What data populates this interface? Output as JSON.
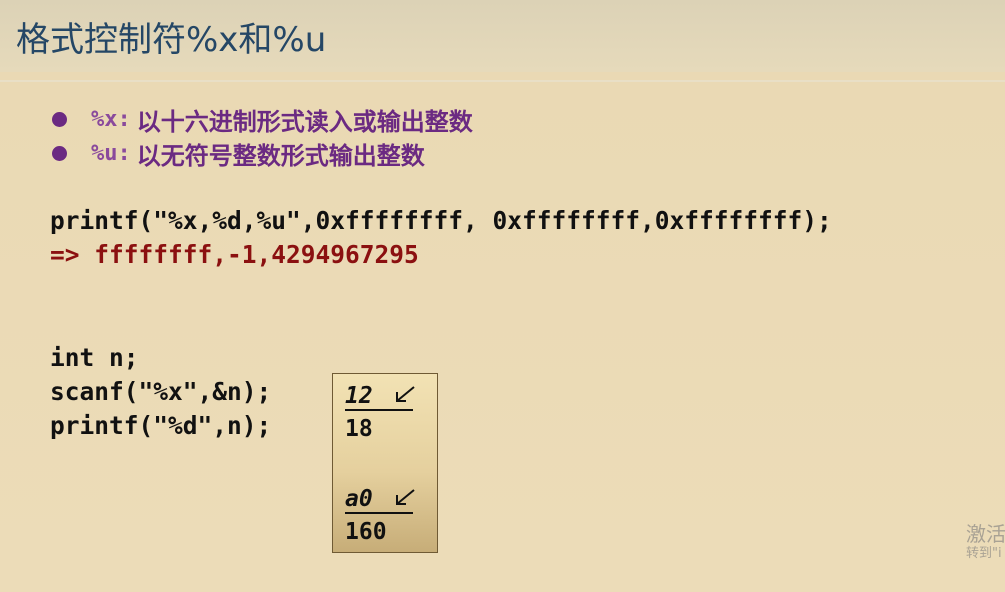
{
  "slide": {
    "title": "格式控制符%x和%u",
    "bullets": [
      {
        "code": "%x:",
        "text": "以十六进制形式读入或输出整数"
      },
      {
        "code": "%u:",
        "text": "以无符号整数形式输出整数"
      }
    ],
    "example1": {
      "code": "printf(\"%x,%d,%u\",0xffffffff, 0xffffffff,0xffffffff);",
      "output": "=> ffffffff,-1,4294967295"
    },
    "example2": {
      "lines": [
        "int n;",
        "scanf(\"%x\",&n);",
        "printf(\"%d\",n);"
      ]
    },
    "io_box": {
      "input1": "12",
      "output1": "18",
      "input2": "a0",
      "output2": "160"
    }
  },
  "watermark": {
    "line1": "激活",
    "line2": "转到\"i"
  }
}
